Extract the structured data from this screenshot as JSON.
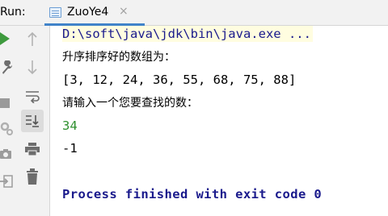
{
  "run_panel": {
    "label": "Run:",
    "tab": {
      "title": "ZuoYe4",
      "close": "×"
    }
  },
  "console": {
    "command": "D:\\soft\\java\\jdk\\bin\\java.exe ...",
    "sorted_prompt": "升序排序好的数组为：",
    "sorted_array": "[3, 12, 24, 36, 55, 68, 75, 88]",
    "input_prompt": "请输入一个您要查找的数：",
    "user_input": "34",
    "result": "-1",
    "exit_message": "Process finished with exit code 0"
  },
  "icons": {
    "left_column": [
      "play-icon",
      "wrench-icon",
      "stop-icon",
      "gear-icon",
      "camera-icon",
      "login-icon"
    ],
    "second_column": [
      "up-arrow-icon",
      "down-arrow-icon",
      "soft-wrap-icon",
      "scroll-to-end-icon",
      "print-icon",
      "trash-icon"
    ]
  },
  "colors": {
    "accent_blue": "#4083c9",
    "run_green": "#3e9a3e",
    "console_text": "#000000",
    "command_text": "#1a1a8c",
    "input_text": "#2e8f2e"
  }
}
